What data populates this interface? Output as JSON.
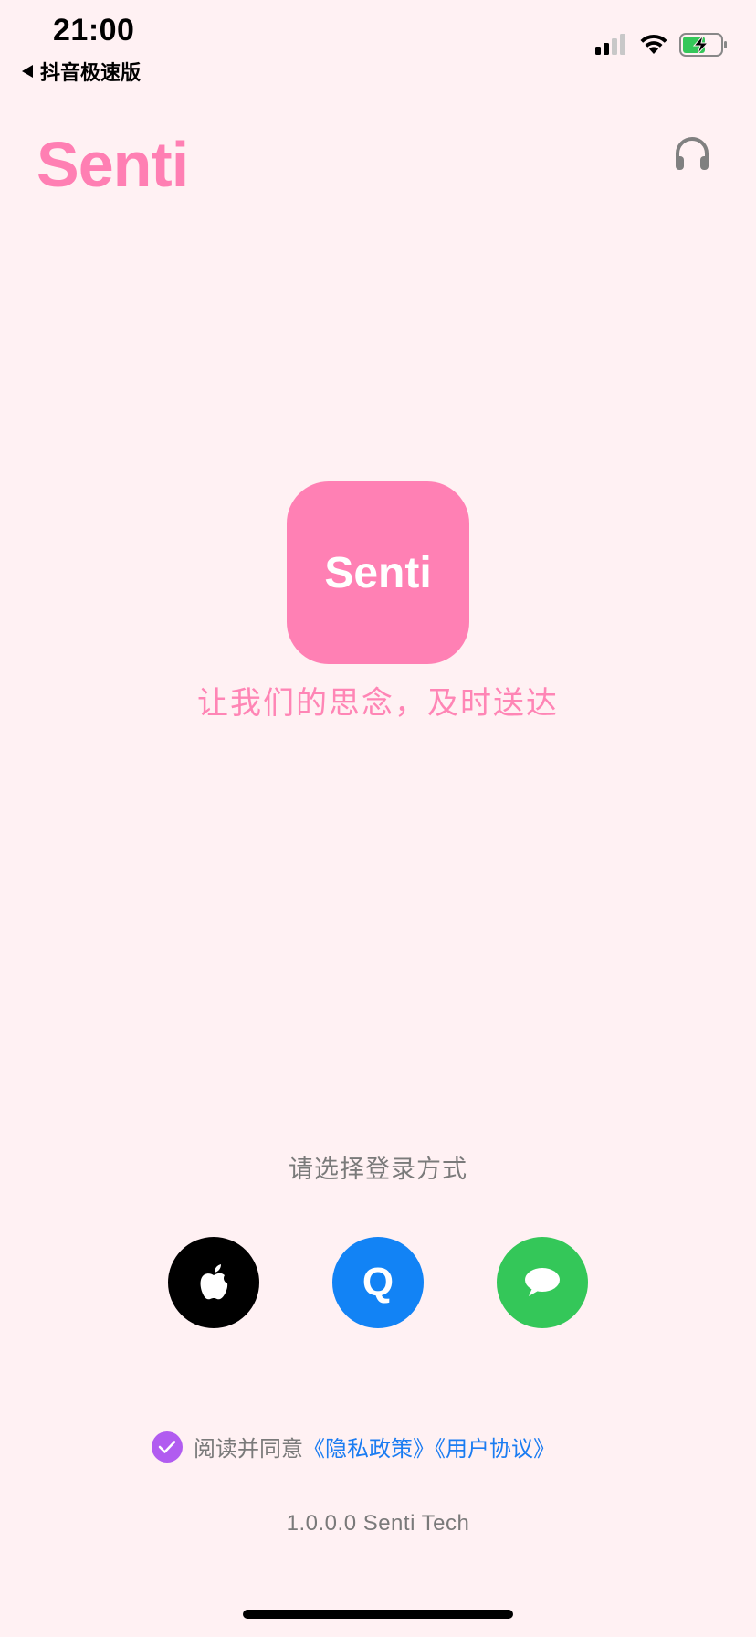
{
  "status_bar": {
    "time": "21:00",
    "back_app": "抖音极速版",
    "signal_icon": "cellular-signal-icon",
    "wifi_icon": "wifi-icon",
    "battery_icon": "battery-charging-icon"
  },
  "header": {
    "title": "Senti",
    "headphone_icon": "headphone-icon"
  },
  "logo": {
    "text": "Senti",
    "color": "#ff80b4"
  },
  "slogan": "让我们的思念，及时送达",
  "login": {
    "label": "请选择登录方式",
    "methods": [
      {
        "name": "apple",
        "icon": "apple-icon",
        "color": "#000000"
      },
      {
        "name": "qq",
        "icon": "qq-icon",
        "letter": "Q",
        "color": "#1283f5"
      },
      {
        "name": "wechat",
        "icon": "message-bubble-icon",
        "color": "#34c759"
      }
    ]
  },
  "agreement": {
    "prefix": "阅读并同意",
    "privacy_link": "《隐私政策》",
    "user_link": "《用户协议》",
    "checked": true
  },
  "version": "1.0.0.0 Senti Tech",
  "colors": {
    "background": "#fff1f3",
    "brand": "#ff7fb3",
    "link": "#1a7cf2",
    "checkbox": "#b15cf0"
  }
}
